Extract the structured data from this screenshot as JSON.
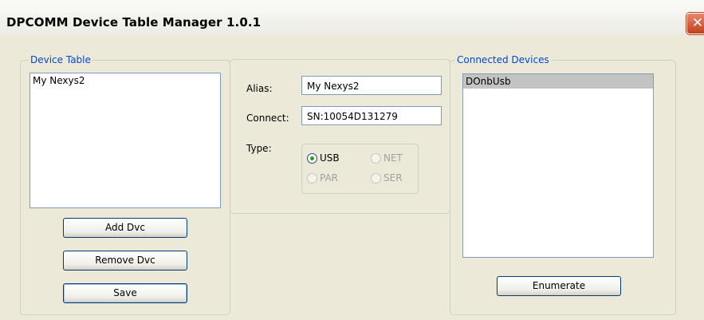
{
  "window": {
    "title": "DPCOMM Device Table Manager 1.0.1",
    "close_symbol": "✕"
  },
  "device_table": {
    "legend": "Device Table",
    "items": [
      "My Nexys2"
    ],
    "buttons": {
      "add": "Add Dvc",
      "remove": "Remove Dvc",
      "save": "Save"
    }
  },
  "details": {
    "alias_label": "Alias:",
    "alias_value": "My Nexys2",
    "connect_label": "Connect:",
    "connect_value": "SN:10054D131279",
    "type_label": "Type:",
    "types": [
      {
        "label": "USB",
        "checked": true,
        "enabled": true
      },
      {
        "label": "NET",
        "checked": false,
        "enabled": false
      },
      {
        "label": "PAR",
        "checked": false,
        "enabled": false
      },
      {
        "label": "SER",
        "checked": false,
        "enabled": false
      }
    ]
  },
  "connected_devices": {
    "legend": "Connected Devices",
    "items": [
      "DOnbUsb"
    ],
    "selected_index": 0,
    "enumerate_label": "Enumerate"
  }
}
